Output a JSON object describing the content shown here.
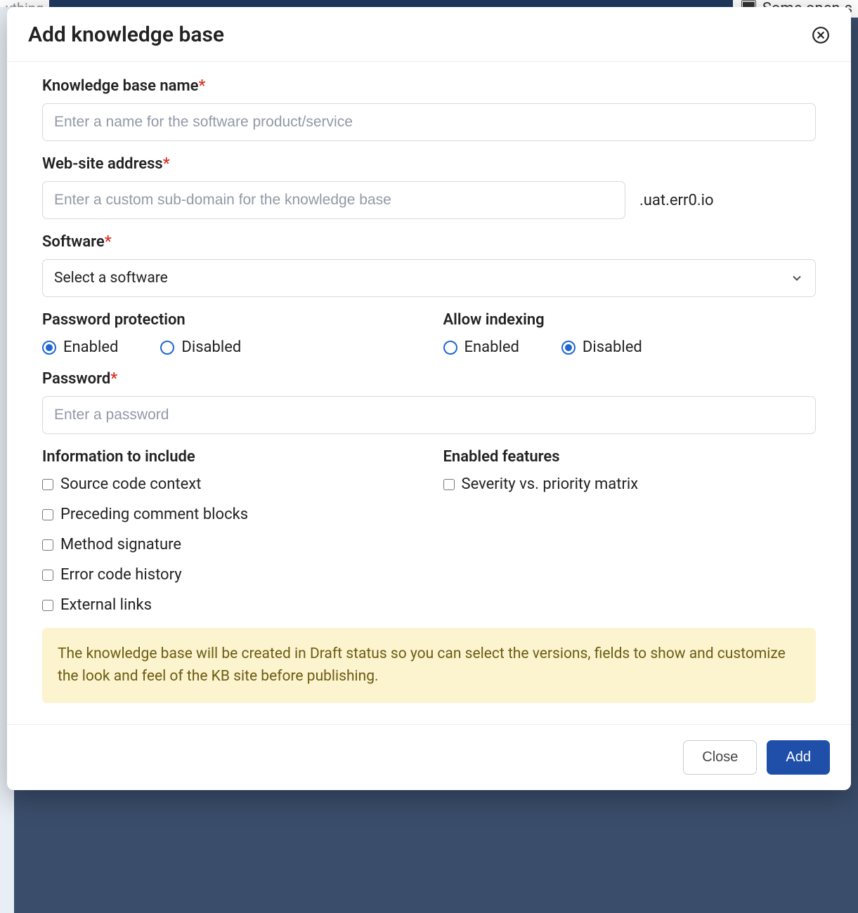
{
  "background": {
    "partial_left": "ything",
    "partial_right": "Some open-s"
  },
  "modal": {
    "title": "Add knowledge base",
    "fields": {
      "kb_name": {
        "label": "Knowledge base name",
        "placeholder": "Enter a name for the software product/service",
        "required": true
      },
      "website": {
        "label": "Web-site address",
        "placeholder": "Enter a custom sub-domain for the knowledge base",
        "suffix": ".uat.err0.io",
        "required": true
      },
      "software": {
        "label": "Software",
        "placeholder": "Select a software",
        "required": true
      },
      "password_protection": {
        "label": "Password protection",
        "options": [
          "Enabled",
          "Disabled"
        ],
        "selected": "Enabled"
      },
      "allow_indexing": {
        "label": "Allow indexing",
        "options": [
          "Enabled",
          "Disabled"
        ],
        "selected": "Disabled"
      },
      "password": {
        "label": "Password",
        "placeholder": "Enter a password",
        "required": true
      },
      "info_include": {
        "label": "Information to include",
        "items": [
          "Source code context",
          "Preceding comment blocks",
          "Method signature",
          "Error code history",
          "External links"
        ]
      },
      "enabled_features": {
        "label": "Enabled features",
        "items": [
          "Severity vs. priority matrix"
        ]
      }
    },
    "notice": "The knowledge base will be created in Draft status so you can select the versions, fields to show and customize the look and feel of the KB site before publishing.",
    "footer": {
      "close": "Close",
      "add": "Add"
    }
  }
}
